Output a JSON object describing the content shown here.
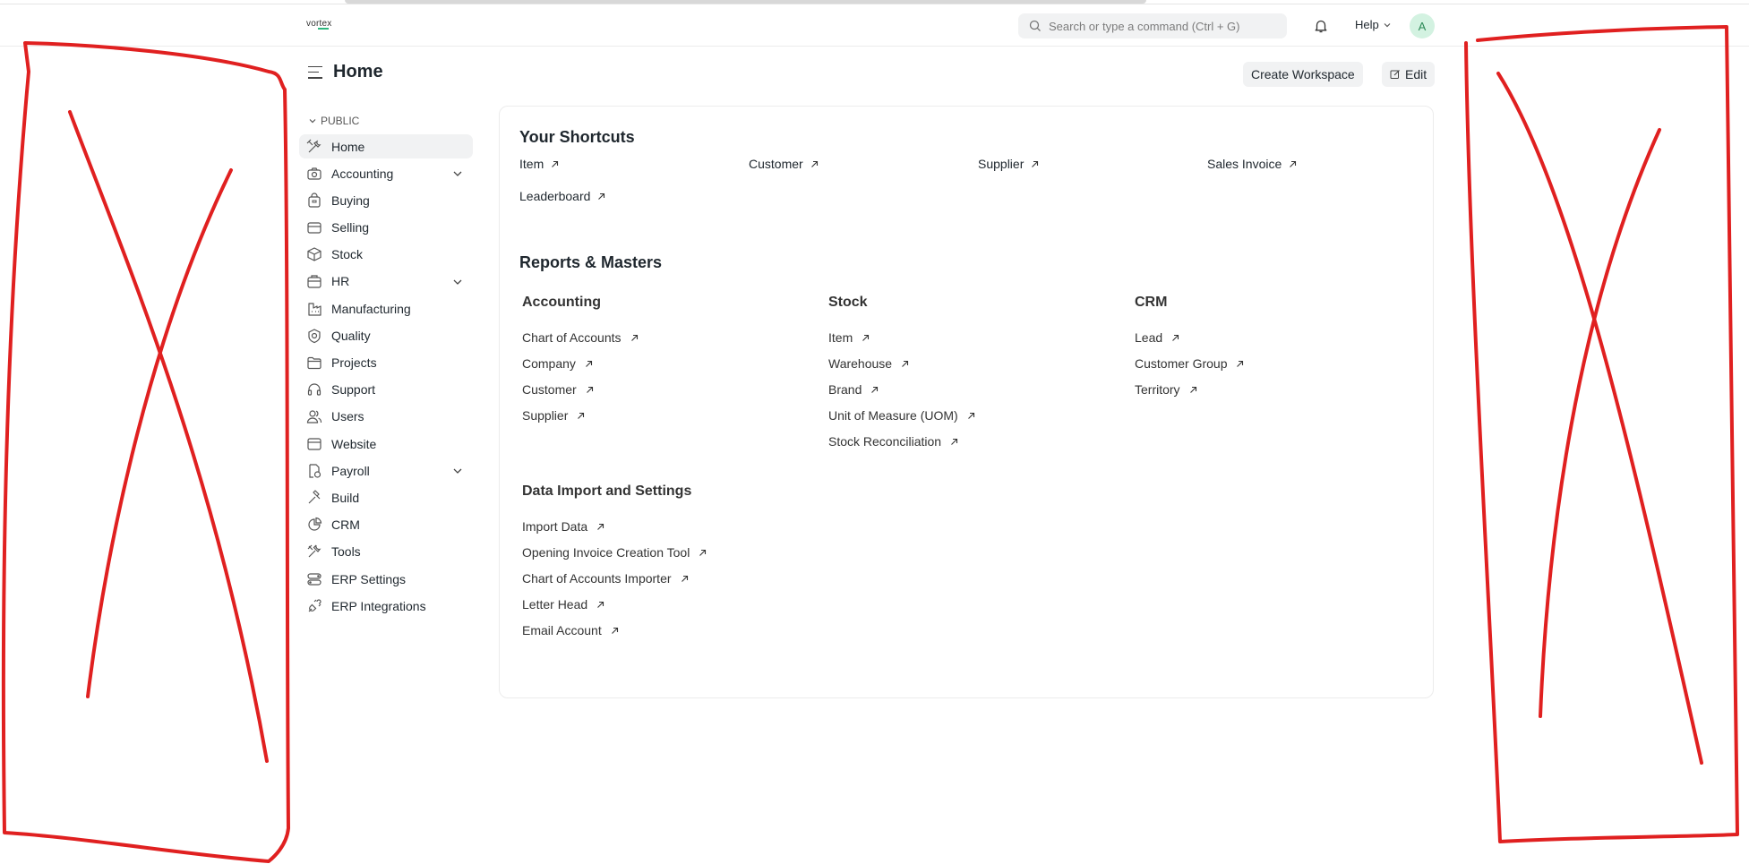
{
  "brand": {
    "logo_text": "vortex",
    "accent_color": "#2cb67d"
  },
  "search": {
    "placeholder": "Search or type a command (Ctrl + G)"
  },
  "navbar": {
    "help_label": "Help",
    "avatar_initial": "A",
    "notification_icon": "bell-icon"
  },
  "page": {
    "title": "Home"
  },
  "actions": {
    "create_workspace_label": "Create Workspace",
    "edit_label": "Edit"
  },
  "sidebar": {
    "section_label": "PUBLIC",
    "items": [
      {
        "label": "Home",
        "icon": "tools-icon",
        "active": true
      },
      {
        "label": "Accounting",
        "icon": "camera-icon",
        "expandable": true
      },
      {
        "label": "Buying",
        "icon": "bag-icon"
      },
      {
        "label": "Selling",
        "icon": "card-icon"
      },
      {
        "label": "Stock",
        "icon": "box-icon"
      },
      {
        "label": "HR",
        "icon": "briefcase-icon",
        "expandable": true
      },
      {
        "label": "Manufacturing",
        "icon": "factory-icon"
      },
      {
        "label": "Quality",
        "icon": "badge-icon"
      },
      {
        "label": "Projects",
        "icon": "folder-icon"
      },
      {
        "label": "Support",
        "icon": "headset-icon"
      },
      {
        "label": "Users",
        "icon": "users-icon"
      },
      {
        "label": "Website",
        "icon": "browser-icon"
      },
      {
        "label": "Payroll",
        "icon": "receipt-icon",
        "expandable": true
      },
      {
        "label": "Build",
        "icon": "hammer-icon"
      },
      {
        "label": "CRM",
        "icon": "pie-chart-icon"
      },
      {
        "label": "Tools",
        "icon": "wrench-icon"
      },
      {
        "label": "ERP Settings",
        "icon": "settings-toggle-icon"
      },
      {
        "label": "ERP Integrations",
        "icon": "plug-icon"
      }
    ]
  },
  "shortcuts": {
    "title": "Your Shortcuts",
    "items": [
      "Item",
      "Customer",
      "Supplier",
      "Sales Invoice",
      "Leaderboard"
    ]
  },
  "reports": {
    "title": "Reports & Masters",
    "groups": [
      {
        "title": "Accounting",
        "links": [
          "Chart of Accounts",
          "Company",
          "Customer",
          "Supplier"
        ]
      },
      {
        "title": "Stock",
        "links": [
          "Item",
          "Warehouse",
          "Brand",
          "Unit of Measure (UOM)",
          "Stock Reconciliation"
        ]
      },
      {
        "title": "CRM",
        "links": [
          "Lead",
          "Customer Group",
          "Territory"
        ]
      },
      {
        "title": "Data Import and Settings",
        "links": [
          "Import Data",
          "Opening Invoice Creation Tool",
          "Chart of Accounts Importer",
          "Letter Head",
          "Email Account"
        ]
      }
    ]
  },
  "annotation": {
    "color": "#e02020"
  }
}
